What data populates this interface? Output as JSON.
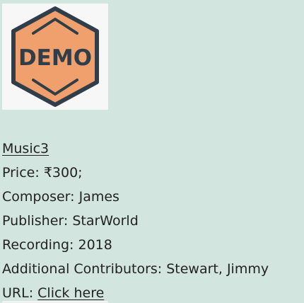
{
  "product": {
    "image": {
      "icon": "demo-hexagon-icon",
      "badge_text": "DEMO",
      "colors": {
        "fill": "#f0a06c",
        "outline": "#2f3e49",
        "text": "#2f3e49",
        "frame": "#f7f7f7"
      }
    },
    "title": "Music3",
    "price_label": "Price:",
    "price_value": "₹300;",
    "composer_label": "Composer:",
    "composer_value": "James",
    "publisher_label": "Publisher:",
    "publisher_value": "StarWorld",
    "recording_label": "Recording:",
    "recording_value": "2018",
    "contributors_label": "Additional Contributors:",
    "contributors_value": "Stewart, Jimmy",
    "url_label": "URL:",
    "url_link": "Click here"
  },
  "page": {
    "background": "#d3e5df"
  }
}
